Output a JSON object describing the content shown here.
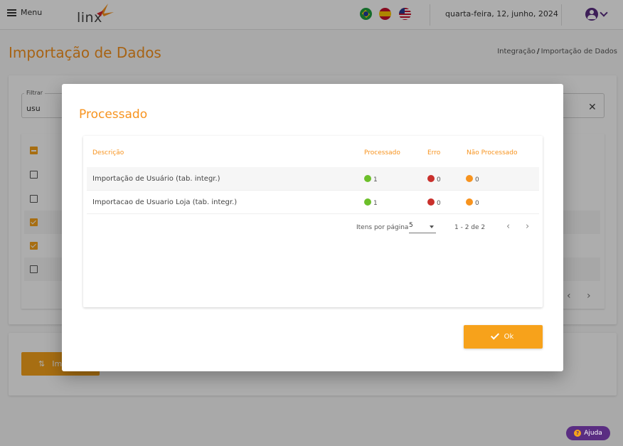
{
  "header": {
    "menu_label": "Menu",
    "logo_text": "linx",
    "date": "quarta-feira, 12, junho, 2024"
  },
  "page": {
    "title": "Importação de Dados",
    "breadcrumb": [
      "Integração",
      "Importação de Dados"
    ]
  },
  "filter": {
    "label": "Filtrar",
    "value": "usu"
  },
  "actions": {
    "import_label": "Im"
  },
  "help": {
    "label": "Ajuda"
  },
  "modal": {
    "title": "Processado",
    "columns": {
      "description": "Descrição",
      "processed": "Processado",
      "error": "Erro",
      "not_processed": "Não Processado"
    },
    "rows": [
      {
        "description": "Importação de Usuário (tab. integr.)",
        "processed": "1",
        "error": "0",
        "not_processed": "0"
      },
      {
        "description": "Importacao de Usuario Loja (tab. integr.)",
        "processed": "1",
        "error": "0",
        "not_processed": "0"
      }
    ],
    "pagination": {
      "items_per_page_label": "Itens por página",
      "page_size": "5",
      "range": "1 - 2 de 2"
    },
    "ok_label": "Ok"
  },
  "colors": {
    "accent": "#f7931e",
    "processed": "#6cbf2a",
    "error": "#c9302c",
    "not_processed": "#f7931e",
    "brand_purple": "#5a2d82"
  }
}
